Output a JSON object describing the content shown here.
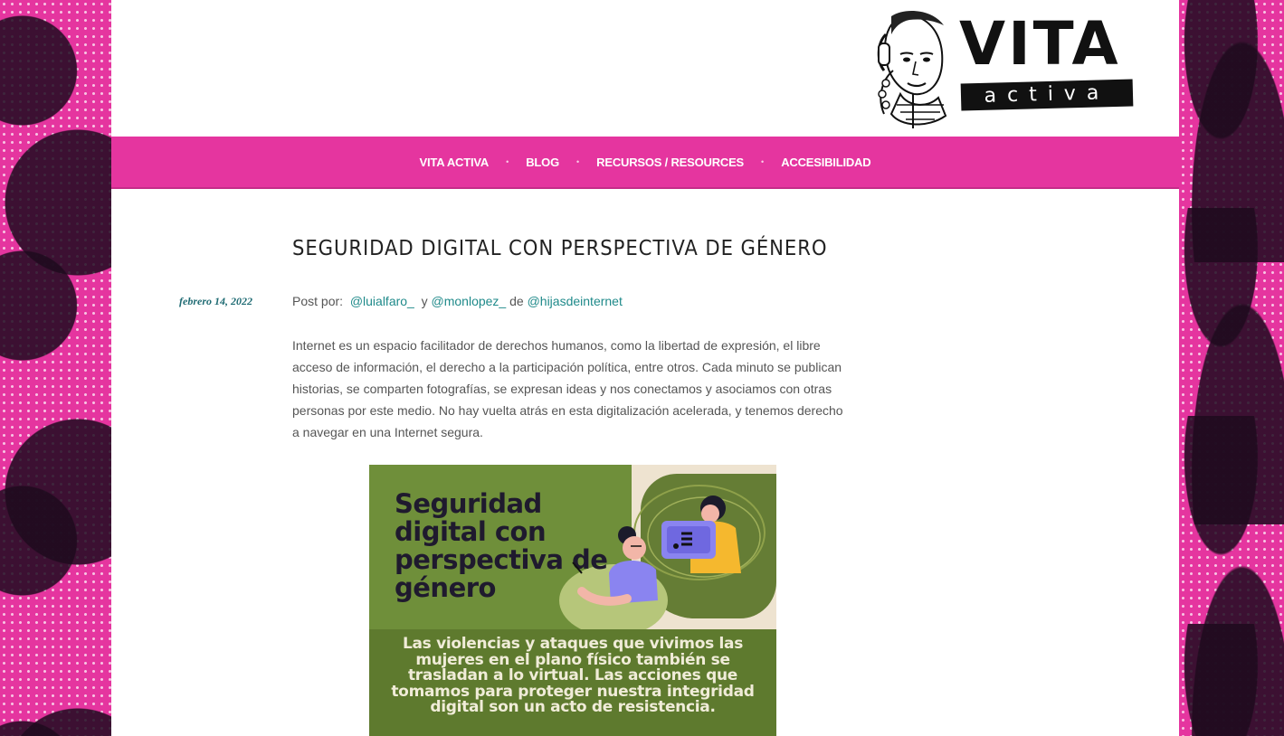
{
  "site": {
    "logo_alt": "Vita Activa",
    "logo_main": "VITA",
    "logo_sub": "activa"
  },
  "nav": {
    "items": [
      {
        "label": "VITA ACTIVA"
      },
      {
        "label": "BLOG"
      },
      {
        "label": "RECURSOS / RESOURCES"
      },
      {
        "label": "ACCESIBILIDAD"
      }
    ],
    "separator": "•"
  },
  "post": {
    "title": "SEGURIDAD DIGITAL CON PERSPECTIVA DE GÉNERO",
    "date": "febrero 14, 2022",
    "byline": {
      "prefix": "Post por:",
      "author1": "@luialfaro_",
      "joiner": "y",
      "author2": "@monlopez_",
      "of": "de",
      "org": "@hijasdeinternet"
    },
    "body": "Internet es un espacio facilitador de derechos humanos, como la libertad de expresión, el libre acceso de información, el derecho a la participación política, entre otros. Cada minuto se publican historias, se comparten fotografías, se expresan ideas y nos conectamos y asociamos con otras personas por este medio. No hay vuelta atrás en esta digitalización acelerada, y tenemos derecho a navegar en una Internet segura."
  },
  "feature_image": {
    "heading": "Seguridad digital con perspectiva de género",
    "text": "Las violencias y ataques que vivimos las mujeres en el plano físico también se trasladan a lo virtual. Las acciones que tomamos para proteger nuestra integridad digital son un acto de resistencia."
  },
  "colors": {
    "brand_pink": "#e5359f",
    "link_teal": "#1f8a8a",
    "image_green": "#5e7a2e"
  }
}
